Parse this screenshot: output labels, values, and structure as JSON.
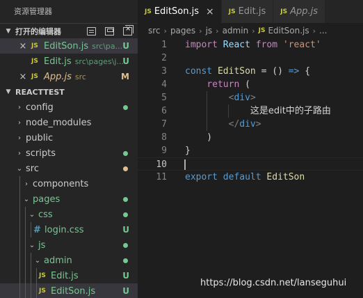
{
  "sidebar": {
    "title": "资源管理器",
    "open_editors": {
      "label": "打开的编辑器",
      "files": [
        {
          "close": "×",
          "badge": "JS",
          "name": "EditSon.js",
          "path": "src\\pa...",
          "status": "U"
        },
        {
          "close": "",
          "badge": "JS",
          "name": "Edit.js",
          "path": "src\\pages\\j...",
          "status": "U"
        },
        {
          "close": "×",
          "badge": "JS",
          "name": "App.js",
          "path": "src",
          "status": "M"
        }
      ]
    },
    "project": {
      "label": "REACTTEST",
      "tree": [
        {
          "name": "config",
          "chev": "›"
        },
        {
          "name": "node_modules",
          "chev": "›"
        },
        {
          "name": "public",
          "chev": "›"
        },
        {
          "name": "scripts",
          "chev": "›"
        },
        {
          "name": "src",
          "chev": "⌄"
        },
        {
          "name": "components",
          "chev": "›"
        },
        {
          "name": "pages",
          "chev": "⌄"
        },
        {
          "name": "css",
          "chev": "⌄"
        },
        {
          "name": "login.css",
          "badge": "#",
          "status": "U"
        },
        {
          "name": "js",
          "chev": "⌄"
        },
        {
          "name": "admin",
          "chev": "⌄"
        },
        {
          "name": "Edit.js",
          "badge": "JS",
          "status": "U"
        },
        {
          "name": "EditSon.js",
          "badge": "JS",
          "status": "U"
        }
      ]
    }
  },
  "tabs": [
    {
      "badge": "JS",
      "label": "EditSon.js",
      "close": "×",
      "active": true
    },
    {
      "badge": "JS",
      "label": "Edit.js"
    },
    {
      "badge": "JS",
      "label": "App.js"
    }
  ],
  "breadcrumb": {
    "parts": [
      "src",
      "pages",
      "js",
      "admin"
    ],
    "sep": "›",
    "badge": "JS",
    "file": "EditSon.js",
    "more": "..."
  },
  "editor": {
    "current_line": 10,
    "lines": [
      {
        "n": "1",
        "tokens": [
          [
            "kw2",
            "import"
          ],
          [
            "punc",
            " "
          ],
          [
            "ident",
            "React"
          ],
          [
            "punc",
            " "
          ],
          [
            "kw2",
            "from"
          ],
          [
            "punc",
            " "
          ],
          [
            "str",
            "'react'"
          ]
        ]
      },
      {
        "n": "2",
        "tokens": []
      },
      {
        "n": "3",
        "tokens": [
          [
            "kw",
            "const"
          ],
          [
            "punc",
            " "
          ],
          [
            "fn",
            "EditSon"
          ],
          [
            "punc",
            " = () "
          ],
          [
            "kw",
            "=>"
          ],
          [
            "punc",
            " {"
          ]
        ]
      },
      {
        "n": "4",
        "tokens": [
          [
            "punc",
            "    "
          ],
          [
            "kw2",
            "return"
          ],
          [
            "punc",
            " ("
          ]
        ]
      },
      {
        "n": "5",
        "tokens": [
          [
            "punc",
            "        "
          ],
          [
            "tag",
            "<"
          ],
          [
            "tagname",
            "div"
          ],
          [
            "tag",
            ">"
          ]
        ]
      },
      {
        "n": "6",
        "tokens": [
          [
            "punc",
            "            "
          ],
          [
            "plain",
            "这是edit中的子路由"
          ]
        ]
      },
      {
        "n": "7",
        "tokens": [
          [
            "punc",
            "        "
          ],
          [
            "tag",
            "</"
          ],
          [
            "tagname",
            "div"
          ],
          [
            "tag",
            ">"
          ]
        ]
      },
      {
        "n": "8",
        "tokens": [
          [
            "punc",
            "    )"
          ]
        ]
      },
      {
        "n": "9",
        "tokens": [
          [
            "punc",
            "}"
          ]
        ]
      },
      {
        "n": "10",
        "tokens": []
      },
      {
        "n": "11",
        "tokens": [
          [
            "kw",
            "export"
          ],
          [
            "punc",
            " "
          ],
          [
            "kw",
            "default"
          ],
          [
            "punc",
            " "
          ],
          [
            "fn",
            "EditSon"
          ]
        ]
      }
    ]
  },
  "watermark": "https://blog.csdn.net/lanseguhui"
}
